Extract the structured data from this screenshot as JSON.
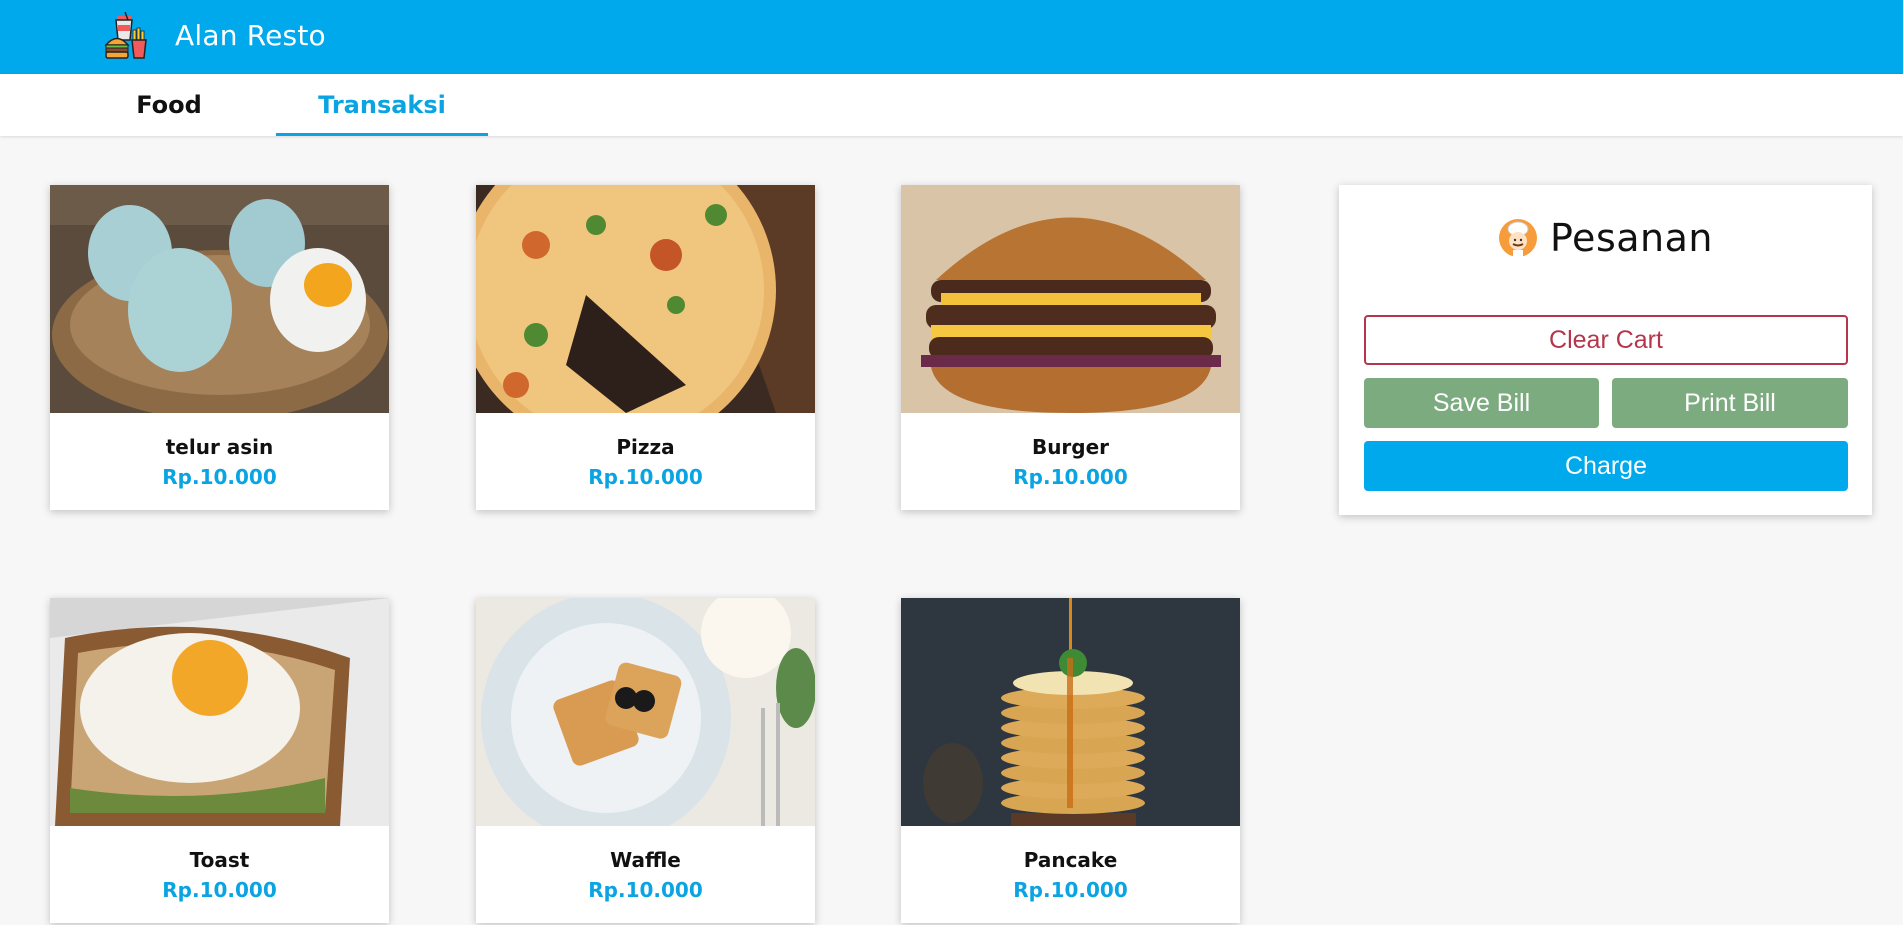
{
  "app": {
    "title": "Alan Resto",
    "logo_icon": "fast-food-logo-icon"
  },
  "tabs": [
    {
      "label": "Food",
      "active": false
    },
    {
      "label": "Transaksi",
      "active": true
    }
  ],
  "colors": {
    "primary": "#00a8ec",
    "price": "#0aa4e3",
    "danger": "#b5364b",
    "success": "#7dab80"
  },
  "menu": [
    {
      "name": "telur asin",
      "price": "Rp.10.000",
      "image": "salted-eggs-photo"
    },
    {
      "name": "Pizza",
      "price": "Rp.10.000",
      "image": "pizza-photo"
    },
    {
      "name": "Burger",
      "price": "Rp.10.000",
      "image": "burger-photo"
    },
    {
      "name": "Toast",
      "price": "Rp.10.000",
      "image": "toast-photo"
    },
    {
      "name": "Waffle",
      "price": "Rp.10.000",
      "image": "waffle-photo"
    },
    {
      "name": "Pancake",
      "price": "Rp.10.000",
      "image": "pancake-photo"
    }
  ],
  "order": {
    "title": "Pesanan",
    "icon": "chef-icon",
    "clear_label": "Clear Cart",
    "save_label": "Save Bill",
    "print_label": "Print Bill",
    "charge_label": "Charge"
  }
}
